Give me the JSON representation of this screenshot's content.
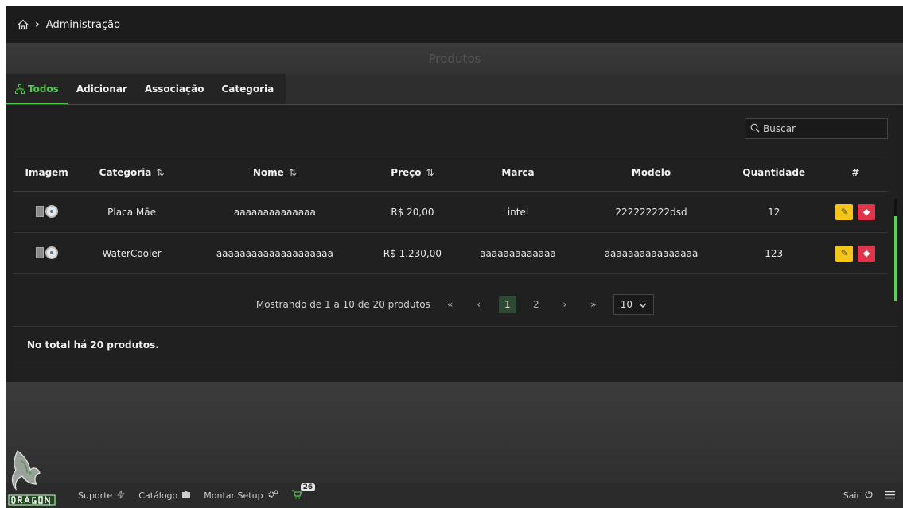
{
  "breadcrumb": {
    "home_icon": "home-icon",
    "section": "Administração"
  },
  "page": {
    "title": "Produtos"
  },
  "tabs": [
    {
      "label": "Todos",
      "icon": "sitemap-icon",
      "active": true
    },
    {
      "label": "Adicionar"
    },
    {
      "label": "Associação"
    },
    {
      "label": "Categoria"
    }
  ],
  "search": {
    "placeholder": "Buscar",
    "icon": "search-icon"
  },
  "table": {
    "columns": [
      "Imagem",
      "Categoria",
      "Nome",
      "Preço",
      "Marca",
      "Modelo",
      "Quantidade",
      "#"
    ],
    "sort_glyph": "⇅",
    "rows": [
      {
        "categoria": "Placa Mãe",
        "nome": "aaaaaaaaaaaaaa",
        "preco": "R$ 20,00",
        "marca": "intel",
        "modelo": "222222222dsd",
        "quantidade": "12"
      },
      {
        "categoria": "WaterCooler",
        "nome": "aaaaaaaaaaaaaaaaaaaa",
        "preco": "R$ 1.230,00",
        "marca": "aaaaaaaaaaaaa",
        "modelo": "aaaaaaaaaaaaaaaa",
        "quantidade": "123"
      }
    ]
  },
  "pagination": {
    "summary": "Mostrando de 1 a 10 de 20 produtos",
    "first": "«",
    "prev": "‹",
    "pages": [
      "1",
      "2"
    ],
    "next": "›",
    "last": "»",
    "per_page": "10"
  },
  "total": "No total há 20 produtos.",
  "footer": {
    "support": "Suporte",
    "catalog": "Catálogo",
    "setup": "Montar Setup",
    "cart_count": "26",
    "logout": "Sair"
  },
  "colors": {
    "accent": "#4ec94e",
    "edit": "#f5c518",
    "delete": "#e0344a"
  }
}
